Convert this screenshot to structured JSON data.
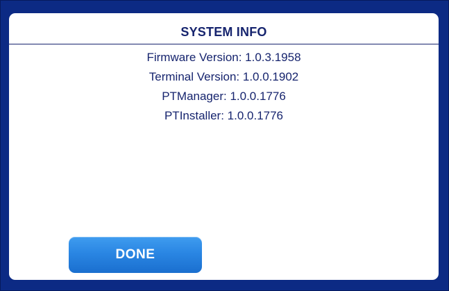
{
  "dialog": {
    "title": "SYSTEM INFO",
    "info_lines": [
      "Firmware Version: 1.0.3.1958",
      "Terminal Version: 1.0.0.1902",
      "PTManager: 1.0.0.1776",
      "PTInstaller: 1.0.0.1776"
    ],
    "done_label": "DONE"
  },
  "colors": {
    "frame_background": "#0c2a84",
    "dialog_background": "#ffffff",
    "text": "#16246e",
    "button": "#2a86e3",
    "button_text": "#ffffff"
  }
}
